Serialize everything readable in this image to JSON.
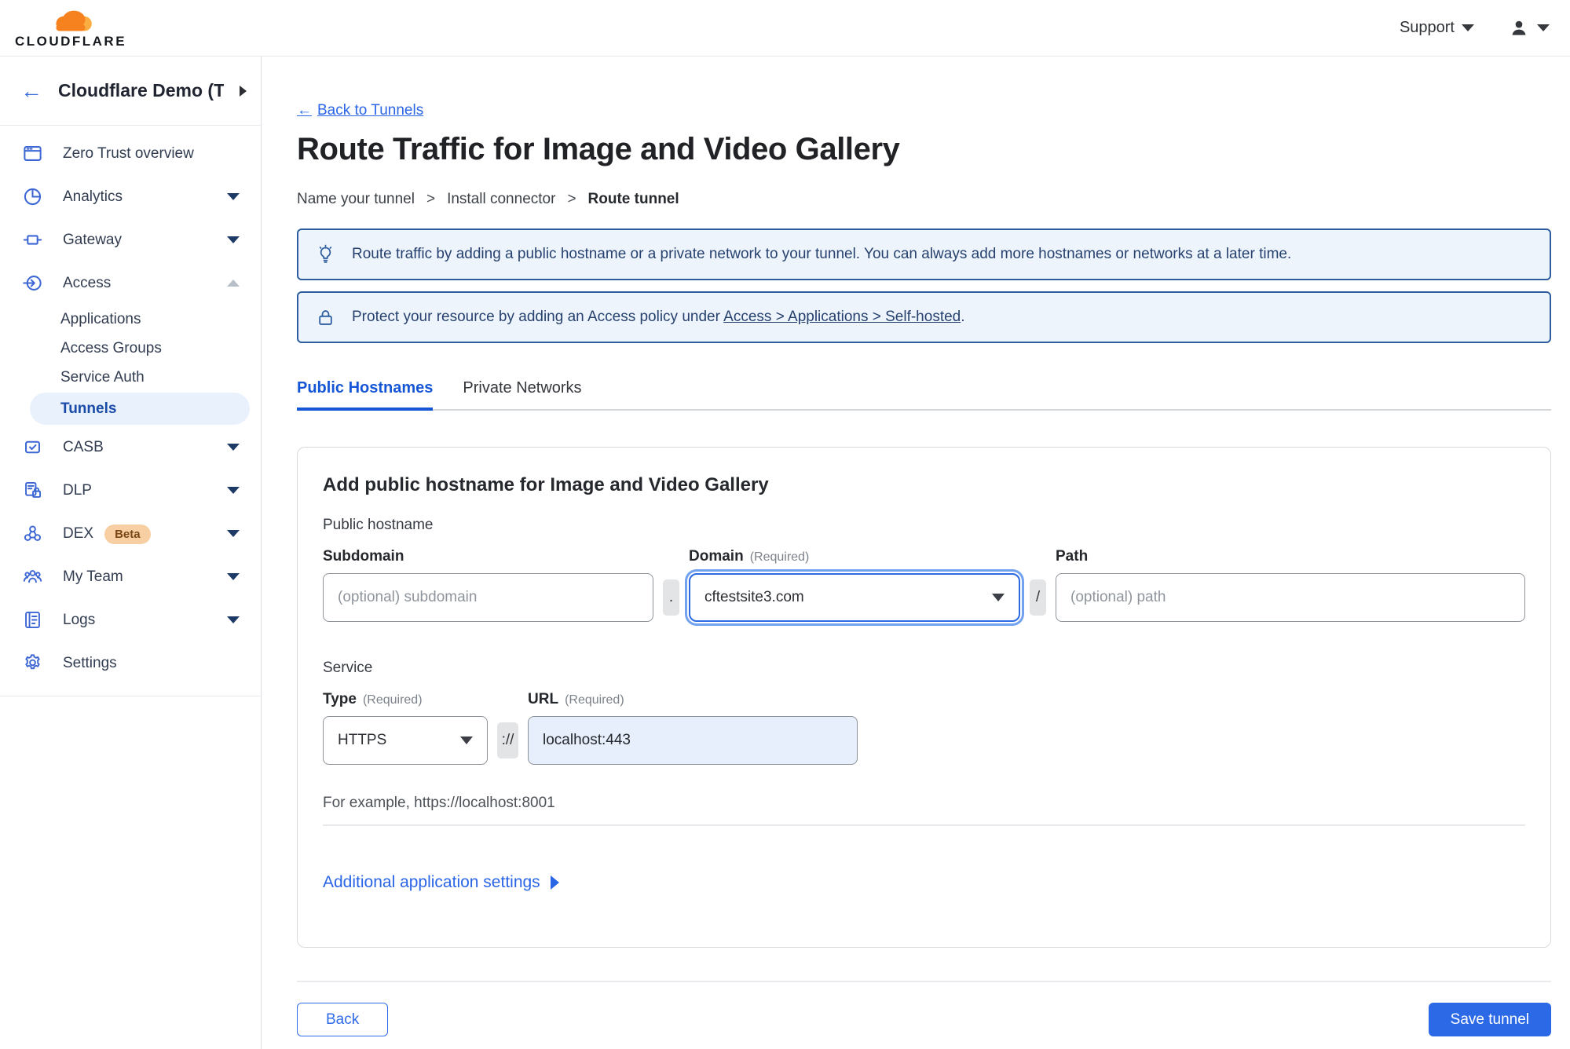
{
  "topbar": {
    "brand": "CLOUDFLARE",
    "support": "Support"
  },
  "sidebar": {
    "back_glyph": "←",
    "account": "Cloudflare Demo (T...",
    "items": [
      {
        "label": "Zero Trust overview",
        "icon": "overview-icon"
      },
      {
        "label": "Analytics",
        "icon": "analytics-icon",
        "chevron": "down"
      },
      {
        "label": "Gateway",
        "icon": "gateway-icon",
        "chevron": "down"
      },
      {
        "label": "Access",
        "icon": "access-icon",
        "chevron": "up"
      },
      {
        "label": "CASB",
        "icon": "casb-icon",
        "chevron": "down"
      },
      {
        "label": "DLP",
        "icon": "dlp-icon",
        "chevron": "down"
      },
      {
        "label": "DEX",
        "icon": "dex-icon",
        "badge": "Beta",
        "chevron": "down"
      },
      {
        "label": "My Team",
        "icon": "team-icon",
        "chevron": "down"
      },
      {
        "label": "Logs",
        "icon": "logs-icon",
        "chevron": "down"
      },
      {
        "label": "Settings",
        "icon": "settings-icon"
      }
    ],
    "access_sub": [
      "Applications",
      "Access Groups",
      "Service Auth",
      "Tunnels"
    ],
    "active_sub": "Tunnels"
  },
  "main": {
    "back_arrow": "←",
    "back_label": "Back to Tunnels",
    "title": "Route Traffic for Image and Video Gallery",
    "breadcrumb": {
      "step1": "Name your tunnel",
      "step2": "Install connector",
      "step3": "Route tunnel",
      "separator": ">"
    },
    "banner_info": "Route traffic by adding a public hostname or a private network to your tunnel. You can always add more hostnames or networks at a later time.",
    "banner_protect_prefix": "Protect your resource by adding an Access policy under",
    "banner_protect_link": "Access > Applications > Self-hosted",
    "banner_protect_suffix": ".",
    "tabs": {
      "public": "Public Hostnames",
      "private": "Private Networks"
    },
    "card": {
      "heading": "Add public hostname for Image and Video Gallery",
      "public_hostname_label": "Public hostname",
      "subdomain_label": "Subdomain",
      "subdomain_placeholder": "(optional) subdomain",
      "dot": ".",
      "domain_label": "Domain",
      "domain_required": "(Required)",
      "domain_value": "cftestsite3.com",
      "slash": "/",
      "path_label": "Path",
      "path_placeholder": "(optional) path",
      "service_label": "Service",
      "type_label": "Type",
      "type_required": "(Required)",
      "type_value": "HTTPS",
      "scheme": "://",
      "url_label": "URL",
      "url_required": "(Required)",
      "url_value": "localhost:443",
      "example": "For example, https://localhost:8001",
      "additional_settings": "Additional application settings"
    },
    "footer": {
      "back": "Back",
      "save": "Save tunnel"
    }
  },
  "colors": {
    "accent_blue": "#2c69e6",
    "banner_border": "#2e5d9f",
    "banner_bg": "#edf4fc",
    "cloudflare_orange": "#f6821f",
    "cloudflare_orange_light": "#fbad41"
  }
}
